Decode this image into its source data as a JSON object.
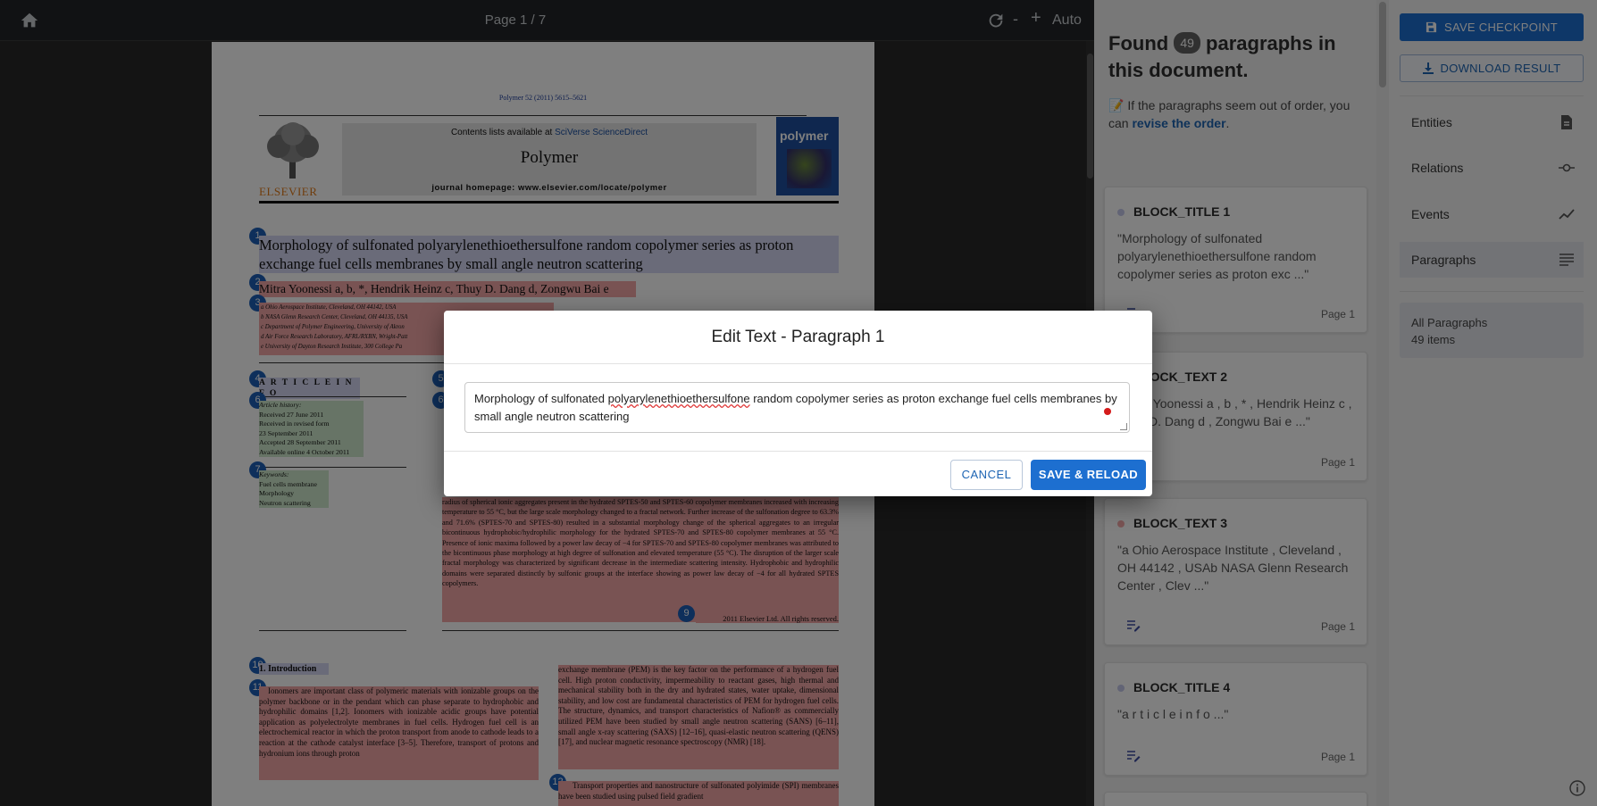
{
  "viewer": {
    "page_label": "Page 1 / 7",
    "zoom_minus": "-",
    "zoom_plus": "+",
    "zoom_mode": "Auto"
  },
  "document": {
    "citation": "Polymer 52 (2011) 5615–5621",
    "contents_prefix": "Contents lists available at ",
    "contents_link": "SciVerse ScienceDirect",
    "journal": "Polymer",
    "homepage": "journal homepage: www.elsevier.com/locate/polymer",
    "publisher": "ELSEVIER",
    "cover_label": "polymer",
    "title": "Morphology of sulfonated polyarylenethioethersulfone random copolymer series as proton exchange fuel cells membranes by small angle neutron scattering",
    "authors": "Mitra Yoonessi a, b, *, Hendrik Heinz c, Thuy D. Dang d, Zongwu Bai e",
    "affiliations": [
      "a Ohio Aerospace Institute, Cleveland, OH 44142, USA",
      "b NASA Glenn Research Center, Cleveland, OH 44135, USA",
      "c Department of Polymer Engineering, University of Akron",
      "d Air Force Research Laboratory, AFRL/RXBN, Wright-Patt",
      "e University of Dayton Research Institute, 300 College Pa"
    ],
    "article_info": "A R T I C L E  I N F O",
    "history": [
      "Article history:",
      "Received 27 June 2011",
      "Received in revised form",
      "23 September 2011",
      "Accepted 28 September 2011",
      "Available online 4 October 2011"
    ],
    "keywords": [
      "Keywords:",
      "Fuel cells membrane",
      "Morphology",
      "Neutron scattering"
    ],
    "abstract": "radius of spherical ionic aggregates present in the hydrated SPTES-50 and SPTES-60 copolymer membranes increased with increasing temperature to 55 °C, but the large scale morphology changed to a fractal network. Further increase of the sulfonation degree to 63.3% and 71.6% (SPTES-70 and SPTES-80) resulted in a substantial morphology change of the spherical aggregates to an irregular bicontinuous hydrophobic/hydrophilic morphology for the hydrated SPTES-70 and SPTES-80 copolymer membranes at 55 °C. Presence of ionic maxima followed by a power law decay of −4 for SPTES-70 and SPTES-80 copolymer membranes was attributed to the bicontinuous phase morphology at high degree of sulfonation and elevated temperature (55 °C). The disruption of the larger scale fractal morphology was characterized by significant decrease in the intermediate scattering intensity. Hydrophobic and hydrophilic domains were separated distinctly by sulfonic groups at the interface showing as power law decay of −4 for all hydrated SPTES copolymers.",
    "copyright": "2011 Elsevier Ltd. All rights reserved.",
    "intro_heading": "1. Introduction",
    "intro_left": "Ionomers are important class of polymeric materials with ionizable groups on the polymer backbone or in the pendant which can phase separate to hydrophobic and hydrophilic domains [1,2]. Ionomers with ionizable acidic groups have potential application as polyelectrolyte membranes in fuel cells. Hydrogen fuel cell is an electrochemical reactor in which the proton transport from anode to cathode leads to a reaction at the cathode catalyst interface [3–5]. Therefore, transport of protons and hydronium ions through proton",
    "intro_right": "exchange membrane (PEM) is the key factor on the performance of a hydrogen fuel cell. High proton conductivity, impermeability to reactant gases, high thermal and mechanical stability both in the dry and hydrated states, water uptake, dimensional stability, and low cost are fundamental characteristics of PEM for hydrogen fuel cells. The structure, dynamics, and transport characteristics of Nafion® as commercially utilized PEM have been studied by small angle neutron scattering (SANS) [6–11], small angle x-ray scattering (SAXS) [12–16], quasi-elastic neutron scattering (QENS) [17], and nuclear magnetic resonance spectroscopy (NMR) [18].",
    "intro_right2": "Transport properties and nanostructure of sulfonated polyimide (SPI) membranes have been studied using pulsed field gradient",
    "badges": [
      "1",
      "2",
      "3",
      "4",
      "5",
      "6",
      "6",
      "7",
      "9",
      "10",
      "11",
      "12"
    ]
  },
  "modal": {
    "title": "Edit Text - Paragraph 1",
    "text_before": "Morphology of sulfonated ",
    "text_misspelled": "polyarylenethioethersulfone",
    "text_after": " random copolymer series as proton exchange fuel cells membranes by small angle neutron scattering",
    "cancel_label": "CANCEL",
    "save_label": "SAVE & RELOAD"
  },
  "paragraphs_panel": {
    "found_prefix": "Found",
    "count": "49",
    "found_suffix": "paragraphs in this document.",
    "note_prefix": "📝 If the paragraphs seem out of order, you can ",
    "note_link": "revise the order",
    "note_suffix": ".",
    "cards": [
      {
        "type": "BLOCK_TITLE 1",
        "text": "\"Morphology of sulfonated polyarylenethioethersulfone random copolymer series as proton exc ...\"",
        "page": "Page 1",
        "dot": "#c5c8ea"
      },
      {
        "type": "BLOCK_TEXT 2",
        "text": "\"Mitra Yoonessi a , b , * , Hendrik Heinz c , Thuy D. Dang d , Zongwu Bai e ...\"",
        "page": "Page 1",
        "dot": "#f2a7a7"
      },
      {
        "type": "BLOCK_TEXT 3",
        "text": "\"a Ohio Aerospace Institute , Cleveland , OH 44142 , USAb NASA Glenn Research Center , Clev ...\"",
        "page": "Page 1",
        "dot": "#f2a7a7"
      },
      {
        "type": "BLOCK_TITLE 4",
        "text": "\"a r t i c l e i n f o ...\"",
        "page": "Page 1",
        "dot": "#c5c8ea"
      }
    ]
  },
  "nav": {
    "save_checkpoint": "SAVE CHECKPOINT",
    "download_result": "DOWNLOAD RESULT",
    "items": [
      {
        "label": "Entities",
        "icon": "document-icon"
      },
      {
        "label": "Relations",
        "icon": "relation-icon"
      },
      {
        "label": "Events",
        "icon": "trend-icon"
      },
      {
        "label": "Paragraphs",
        "icon": "paragraph-icon"
      }
    ],
    "all_paragraphs_label": "All Paragraphs",
    "all_paragraphs_count": "49 items"
  },
  "colors": {
    "primary": "#1d6fd0",
    "title_highlight": "#d5d7f2",
    "text_highlight": "#f2a7a7",
    "info_highlight": "#cfe9cc"
  }
}
